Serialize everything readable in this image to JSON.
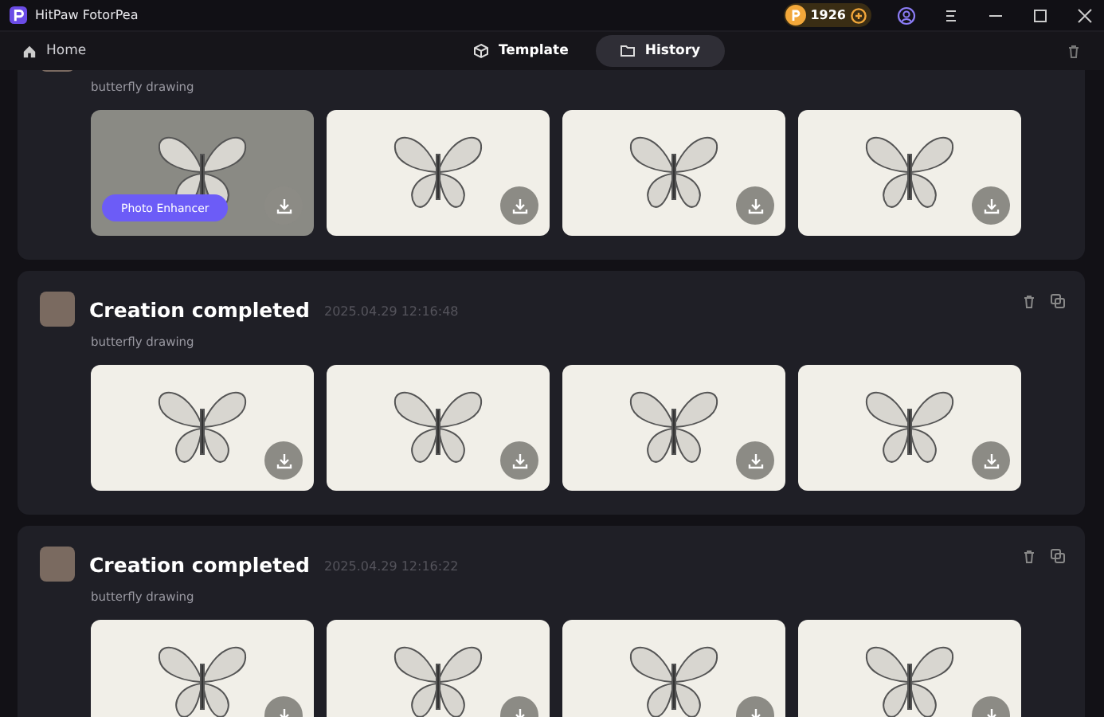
{
  "window": {
    "title": "HitPaw FotorPea",
    "credits": "1926"
  },
  "nav": {
    "home": "Home",
    "tabs": [
      {
        "label": "Template",
        "selected": false
      },
      {
        "label": "History",
        "selected": true
      }
    ]
  },
  "cards": [
    {
      "prompt": "butterfly drawing",
      "images": [
        {
          "hovered": true,
          "badge": "Photo Enhancer"
        },
        {
          "hovered": false
        },
        {
          "hovered": false
        },
        {
          "hovered": false
        }
      ]
    },
    {
      "title": "Creation completed",
      "timestamp": "2025.04.29 12:16:48",
      "prompt": "butterfly drawing",
      "images": [
        {
          "hovered": false
        },
        {
          "hovered": false
        },
        {
          "hovered": false
        },
        {
          "hovered": false
        }
      ]
    },
    {
      "title": "Creation completed",
      "timestamp": "2025.04.29 12:16:22",
      "prompt": "butterfly drawing",
      "images": [
        {
          "hovered": false
        },
        {
          "hovered": false
        },
        {
          "hovered": false
        },
        {
          "hovered": false
        }
      ]
    }
  ]
}
